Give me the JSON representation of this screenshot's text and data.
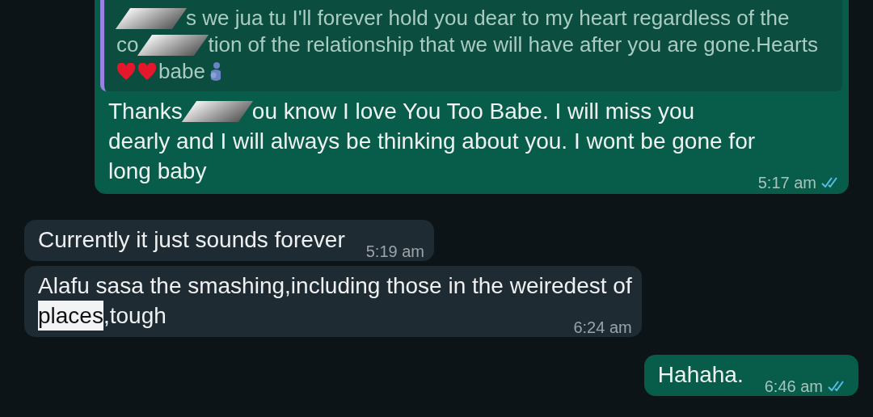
{
  "messages": [
    {
      "kind": "sent",
      "quote": {
        "lines": [
          [
            {
              "kind": "redacted"
            },
            {
              "kind": "text",
              "text": "s we jua tu I'll forever hold you dear to my heart regardless of the"
            }
          ],
          [
            {
              "kind": "text",
              "text": "co"
            },
            {
              "kind": "redacted"
            },
            {
              "kind": "text",
              "text": "tion of the relationship that we will have after you are gone.Hearts"
            }
          ],
          [
            {
              "kind": "heart"
            },
            {
              "kind": "heart"
            },
            {
              "kind": "text",
              "text": "babe"
            },
            {
              "kind": "figure"
            }
          ]
        ]
      },
      "lines": [
        [
          {
            "kind": "text",
            "text": "Thanks"
          },
          {
            "kind": "redacted"
          },
          {
            "kind": "text",
            "text": "ou know I love You Too Babe. I will miss you"
          }
        ],
        [
          {
            "kind": "text",
            "text": "dearly and I will always be thinking about you. I wont be gone for"
          }
        ],
        [
          {
            "kind": "text",
            "text": "long baby"
          }
        ]
      ],
      "time": "5:17 am",
      "read": true
    },
    {
      "kind": "received",
      "lines": [
        [
          {
            "kind": "text",
            "text": "Currently it just sounds forever"
          }
        ]
      ],
      "time": "5:19 am"
    },
    {
      "kind": "received",
      "lines": [
        [
          {
            "kind": "text",
            "text": "Alafu sasa the smashing,including those in the weiredest of"
          }
        ],
        [
          {
            "kind": "text",
            "text": "places",
            "selected": true
          },
          {
            "kind": "text",
            "text": ",tough"
          }
        ]
      ],
      "time": "6:24 am"
    },
    {
      "kind": "sent",
      "lines": [
        [
          {
            "kind": "text",
            "text": "Hahaha."
          }
        ]
      ],
      "time": "6:46 am",
      "read": true
    }
  ]
}
